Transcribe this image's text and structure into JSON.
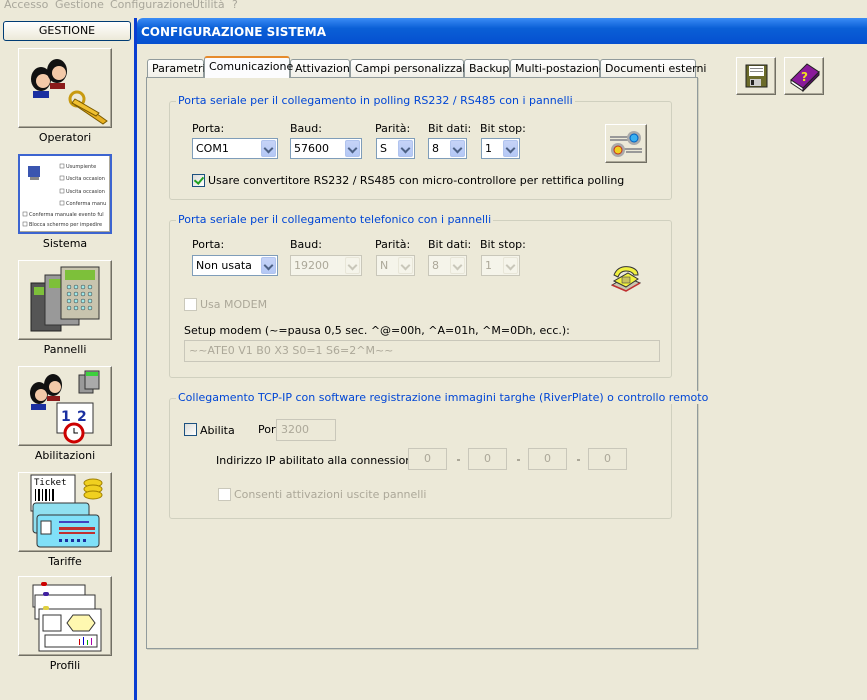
{
  "menu": [
    "Accesso",
    "Gestione",
    "Configurazione",
    "Utilità",
    "?"
  ],
  "sidebar": {
    "header": "GESTIONE",
    "items": [
      {
        "label": "Operatori",
        "icon": "operators-keys-icon"
      },
      {
        "label": "Sistema",
        "icon": "system-settings-icon"
      },
      {
        "label": "Pannelli",
        "icon": "panels-keypad-icon"
      },
      {
        "label": "Abilitazioni",
        "icon": "permissions-calendar-icon"
      },
      {
        "label": "Tariffe",
        "icon": "ticket-tariff-icon"
      },
      {
        "label": "Profili",
        "icon": "profiles-documents-icon"
      }
    ]
  },
  "window": {
    "title": "CONFIGURAZIONE SISTEMA",
    "save_icon": "floppy-save-icon",
    "help_icon": "help-book-icon"
  },
  "tabs": [
    "Parametri",
    "Comunicazione",
    "Attivazioni",
    "Campi personalizzabili",
    "Backup",
    "Multi-postazione",
    "Documenti esterni"
  ],
  "active_tab": "Comunicazione",
  "polling": {
    "title": "Porta seriale per il collegamento in polling RS232 / RS485 con i pannelli",
    "labels": {
      "porta": "Porta:",
      "baud": "Baud:",
      "parita": "Parità:",
      "bitdati": "Bit dati:",
      "bitstop": "Bit stop:"
    },
    "values": {
      "porta": "COM1",
      "baud": "57600",
      "parita": "S",
      "bitdati": "8",
      "bitstop": "1"
    },
    "converter_label": "Usare convertitore RS232 / RS485 con micro-controllore per rettifica polling",
    "converter_checked": true
  },
  "phone": {
    "title": "Porta seriale per il collegamento telefonico con i pannelli",
    "labels": {
      "porta": "Porta:",
      "baud": "Baud:",
      "parita": "Parità:",
      "bitdati": "Bit dati:",
      "bitstop": "Bit stop:"
    },
    "values": {
      "porta": "Non usata",
      "baud": "19200",
      "parita": "N",
      "bitdati": "8",
      "bitstop": "1"
    },
    "modem_label": "Usa MODEM",
    "modem_checked": false,
    "setup_label": "Setup modem (~=pausa 0,5 sec. ^@=00h, ^A=01h, ^M=0Dh, ecc.):",
    "setup_value": "~~ATE0 V1 B0 X3 S0=1 S6=2^M~~"
  },
  "tcp": {
    "title": "Collegamento TCP-IP con software registrazione immagini targhe (RiverPlate) o controllo remoto",
    "enable_label": "Abilita",
    "enable_checked": false,
    "port_label": "Porta:",
    "port_value": "3200",
    "ip_label": "Indirizzo IP abilitato alla connessione:",
    "ip": [
      "0",
      "0",
      "0",
      "0"
    ],
    "allow_label": "Consenti attivazioni uscite pannelli",
    "allow_checked": false
  }
}
